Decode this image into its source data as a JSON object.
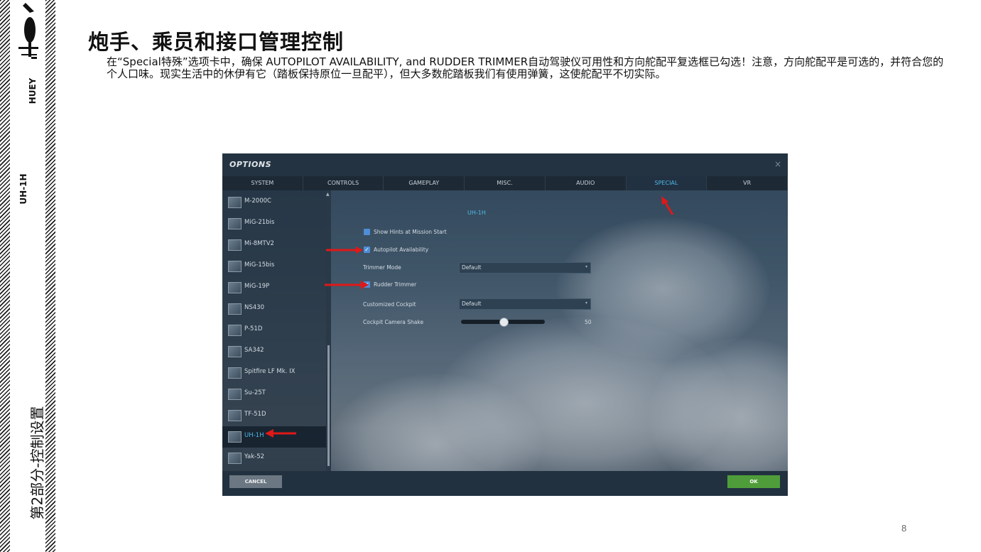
{
  "sidebar": {
    "section": "第2部分-控制设置",
    "aircraft": "UH-1H",
    "nickname": "HUEY",
    "logo_icon": "helicopter-icon"
  },
  "page": {
    "title": "炮手、乘员和接口管理控制",
    "description": "在“Special特殊”选项卡中，确保 AUTOPILOT AVAILABILITY, and RUDDER TRIMMER自动驾驶仪可用性和方向舵配平复选框已勾选！注意，方向舵配平是可选的，并符合您的个人口味。现实生活中的休伊有它（踏板保持原位一旦配平），但大多数舵踏板我们有使用弹簧，这使舵配平不切实际。",
    "page_number": "8"
  },
  "options": {
    "title": "OPTIONS",
    "close": "×",
    "tabs": [
      "SYSTEM",
      "CONTROLS",
      "GAMEPLAY",
      "MISC.",
      "AUDIO",
      "SPECIAL",
      "VR"
    ],
    "active_tab": "SPECIAL",
    "aircraft_list": [
      "M-2000C",
      "MiG-21bis",
      "Mi-8MTV2",
      "MiG-15bis",
      "MiG-19P",
      "NS430",
      "P-51D",
      "SA342",
      "Spitfire LF Mk. IX",
      "Su-25T",
      "TF-51D",
      "UH-1H",
      "Yak-52"
    ],
    "selected_aircraft": "UH-1H",
    "section_title": "UH-1H",
    "settings": {
      "show_hints": {
        "label": "Show Hints at Mission Start",
        "checked": true
      },
      "autopilot": {
        "label": "Autopilot Availability",
        "checked": true
      },
      "trimmer_mode": {
        "label": "Trimmer Mode",
        "value": "Default"
      },
      "rudder_trimmer": {
        "label": "Rudder Trimmer",
        "checked": true
      },
      "custom_cockpit": {
        "label": "Customized Cockpit",
        "value": "Default"
      },
      "camera_shake": {
        "label": "Cockpit Camera Shake",
        "value": "50",
        "level": 0.5
      }
    },
    "cancel_label": "CANCEL",
    "ok_label": "OK",
    "check_glyph": "✓",
    "dropdown_glyph": "▾",
    "scroll_up_glyph": "▲",
    "colors": {
      "accent": "#4fb9e6",
      "ok": "#4f9d3a",
      "annotation": "#e01818"
    }
  }
}
